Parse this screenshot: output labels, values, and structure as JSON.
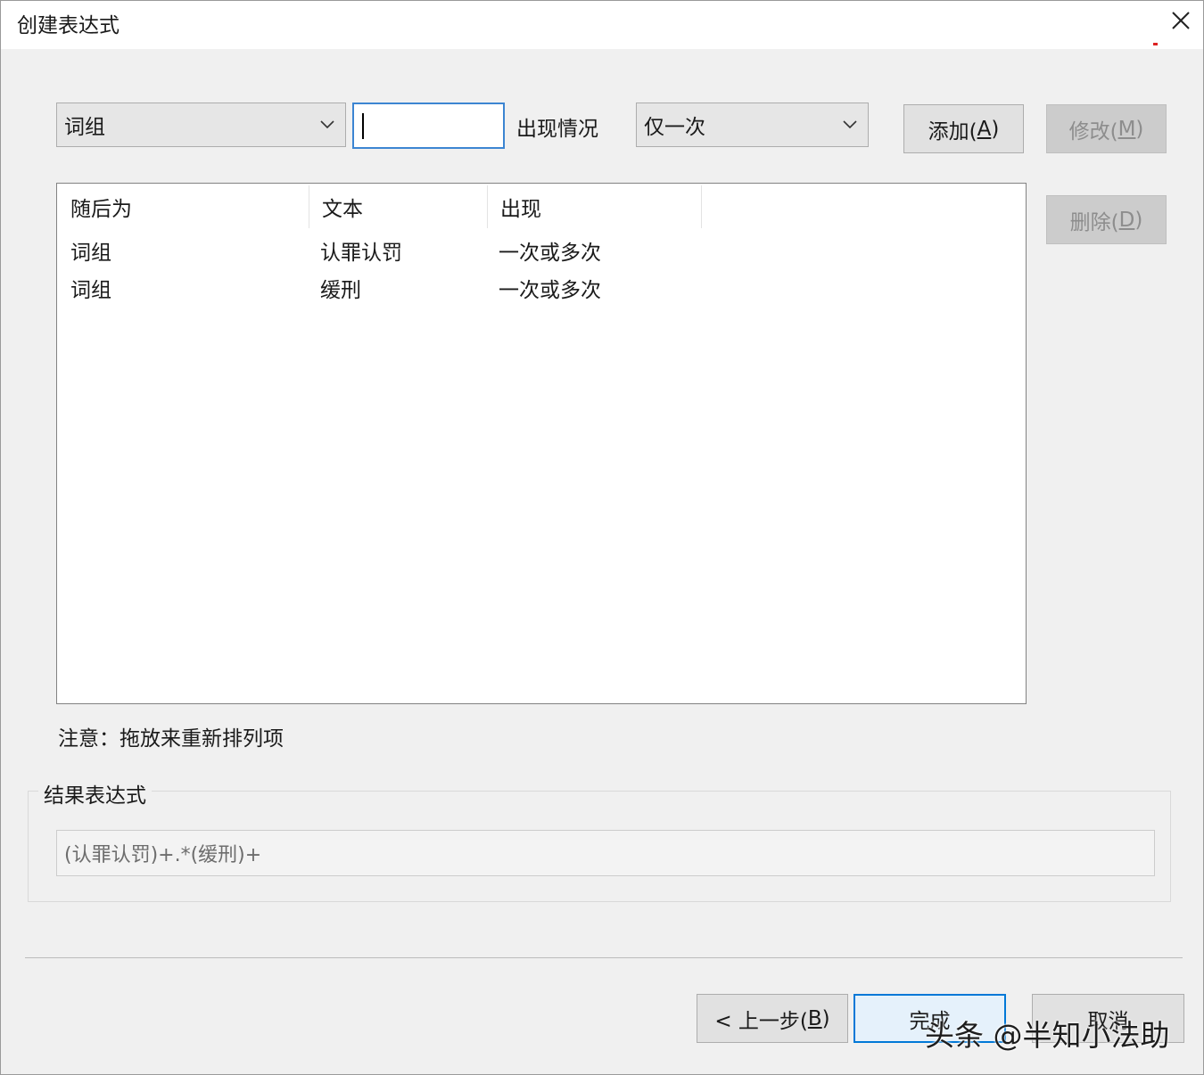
{
  "window": {
    "title": "创建表达式"
  },
  "controls": {
    "type_combo": "词组",
    "text_input": "",
    "occurrence_label": "出现情况",
    "occurrence_combo": "仅一次",
    "add_button": {
      "text": "添加(",
      "mnemonic": "A",
      "suffix": ")"
    },
    "modify_button": {
      "text": "修改(",
      "mnemonic": "M",
      "suffix": ")"
    },
    "delete_button": {
      "text": "删除(",
      "mnemonic": "D",
      "suffix": ")"
    }
  },
  "list": {
    "columns": [
      "随后为",
      "文本",
      "出现"
    ],
    "rows": [
      [
        "词组",
        "认罪认罚",
        "一次或多次"
      ],
      [
        "词组",
        "缓刑",
        "一次或多次"
      ]
    ]
  },
  "note": "注意：拖放来重新排列项",
  "result": {
    "label": "结果表达式",
    "value": "(认罪认罚)+.*(缓刑)+"
  },
  "footer": {
    "back_button": {
      "text": "< 上一步(",
      "mnemonic": "B",
      "suffix": ")"
    },
    "finish_button": "完成",
    "cancel_button": "取消"
  },
  "watermark": "头条 @半知小法助",
  "icons": {
    "close": "close-icon",
    "dropdown": "chevron-down-icon"
  },
  "colors": {
    "focus_border": "#3c85d2",
    "default_button_border": "#0078d7",
    "dialog_bg": "#f0f0f0"
  }
}
